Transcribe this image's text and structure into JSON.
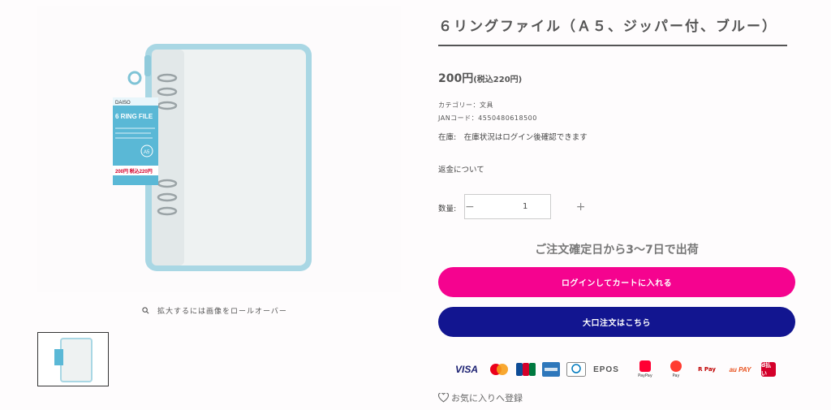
{
  "product": {
    "title": "６リングファイル（Ａ５、ジッパー付、ブルー）",
    "price": "200円",
    "price_tax": "(税込220円)",
    "category": "カテゴリー：文具",
    "jan": "JANコード：4550480618500",
    "stock": "在庫:　在庫状況はログイン後確認できます",
    "refund_link": "返金について"
  },
  "gallery": {
    "zoom_hint": "拡大するには画像をロールオーバー",
    "package_brand": "DAISO",
    "package_title": "6 RING FILE",
    "package_size": "A5",
    "package_price": "200円 税込220円"
  },
  "quantity": {
    "label": "数量:",
    "value": "1",
    "minus": "−",
    "plus": "+"
  },
  "shipping_note": "ご注文確定日から3〜7日で出荷",
  "buttons": {
    "login_cart": "ログインしてカートに入れる",
    "bulk_order": "大口注文はこちら"
  },
  "payments": {
    "visa": "VISA",
    "epos": "EPOS",
    "paypay": "PayPay",
    "merpay": "Pay",
    "rpay": "R Pay",
    "aupay": "au PAY",
    "dbarai": "d払い"
  },
  "favorite": "お気に入りへ登録",
  "colors": {
    "accent_pink": "#f5038f",
    "accent_navy": "#121590",
    "binder_blue": "#a8d8e6"
  }
}
